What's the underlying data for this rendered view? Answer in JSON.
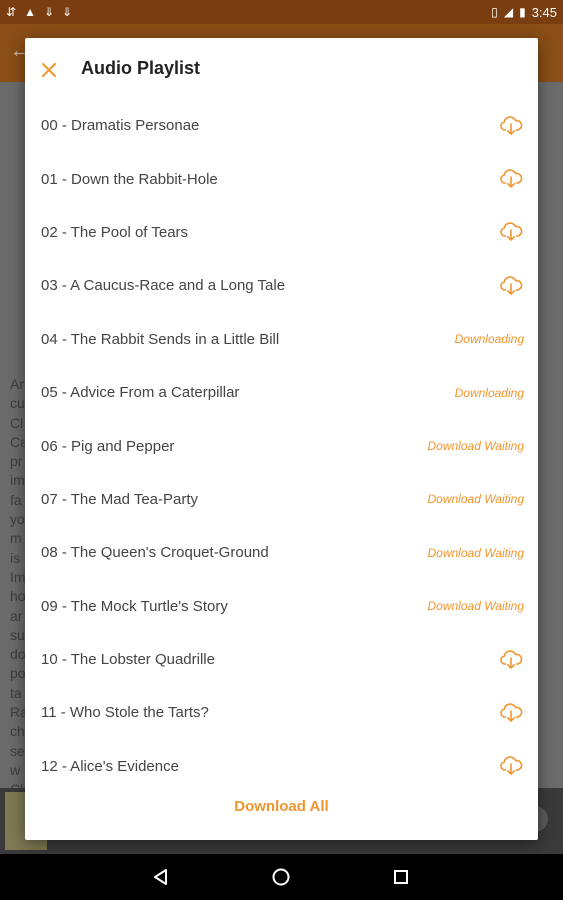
{
  "status_bar": {
    "time": "3:45",
    "icons": [
      "usb-icon",
      "warning-icon",
      "download-icon",
      "download-icon",
      "vibrate-icon",
      "signal-icon",
      "battery-icon"
    ]
  },
  "background_text": "Ar                                                                               ne\ncu\nCl\nCa                                                                               a\npr                                                                               e\nim\nfa                                                                               e\nyo                                                                               s\nm                                                                                n\nis\nIm\nho\nar\nsu\ndo\npo\nta\nRa\nch\nse\nw\nCl                                                                               s.",
  "dialog": {
    "title": "Audio Playlist",
    "download_all_label": "Download All",
    "items": [
      {
        "title": "00 - Dramatis Personae",
        "status": "",
        "icon": "cloud-download-icon"
      },
      {
        "title": "01 - Down the Rabbit-Hole",
        "status": "",
        "icon": "cloud-download-icon"
      },
      {
        "title": "02 - The Pool of Tears",
        "status": "",
        "icon": "cloud-download-icon"
      },
      {
        "title": "03 - A Caucus-Race and a Long Tale",
        "status": "",
        "icon": "cloud-download-icon"
      },
      {
        "title": "04 - The Rabbit Sends in a Little Bill",
        "status": "Downloading",
        "icon": ""
      },
      {
        "title": "05 - Advice From a Caterpillar",
        "status": "Downloading",
        "icon": ""
      },
      {
        "title": "06 - Pig and Pepper",
        "status": "Download Waiting",
        "icon": ""
      },
      {
        "title": "07 - The Mad Tea-Party",
        "status": "Download Waiting",
        "icon": ""
      },
      {
        "title": "08 - The Queen's Croquet-Ground",
        "status": "Download Waiting",
        "icon": ""
      },
      {
        "title": "09 - The Mock Turtle's Story",
        "status": "Download Waiting",
        "icon": ""
      },
      {
        "title": "10 - The Lobster Quadrille",
        "status": "",
        "icon": "cloud-download-icon"
      },
      {
        "title": "11 - Who Stole the Tarts?",
        "status": "",
        "icon": "cloud-download-icon"
      },
      {
        "title": "12 - Alice's Evidence",
        "status": "",
        "icon": "cloud-download-icon"
      }
    ]
  },
  "colors": {
    "accent": "#f0962e",
    "status_bar": "#7a3d0f",
    "toolbar": "#8a4e16"
  }
}
